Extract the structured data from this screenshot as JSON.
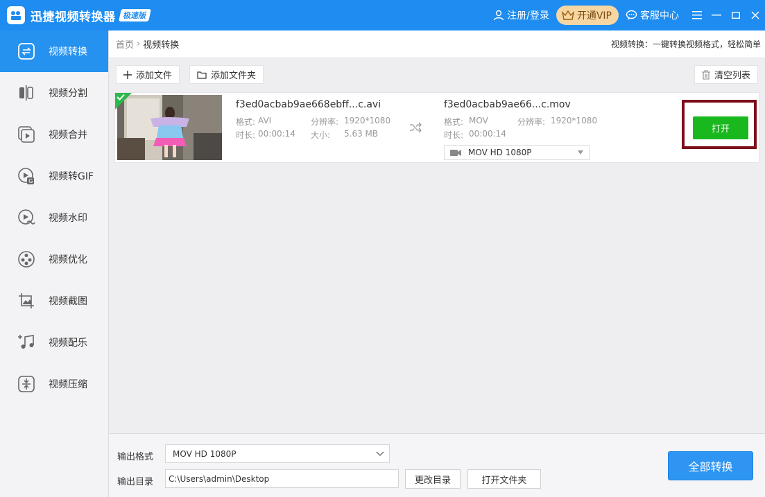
{
  "app": {
    "title": "迅捷视频转换器",
    "edition": "极速版",
    "login_label": "注册/登录",
    "vip_label": "开通VIP",
    "service_label": "客服中心"
  },
  "sidebar": {
    "items": [
      {
        "label": "视频转换",
        "icon": "convert-icon",
        "active": true
      },
      {
        "label": "视频分割",
        "icon": "split-icon"
      },
      {
        "label": "视频合并",
        "icon": "merge-icon"
      },
      {
        "label": "视频转GIF",
        "icon": "gif-icon"
      },
      {
        "label": "视频水印",
        "icon": "watermark-icon"
      },
      {
        "label": "视频优化",
        "icon": "optimize-icon"
      },
      {
        "label": "视频截图",
        "icon": "screenshot-icon"
      },
      {
        "label": "视频配乐",
        "icon": "music-icon"
      },
      {
        "label": "视频压缩",
        "icon": "compress-icon"
      }
    ]
  },
  "breadcrumb": {
    "home": "首页",
    "current": "视频转换"
  },
  "tagline": "视频转换：一键转换视频格式，轻松简单",
  "toolbar": {
    "add_file": "添加文件",
    "add_folder": "添加文件夹",
    "clear_list": "清空列表"
  },
  "file": {
    "source_name": "f3ed0acbab9ae668ebff...c.avi",
    "source_format_label": "格式:",
    "source_format": "AVI",
    "source_resolution_label": "分辨率:",
    "source_resolution": "1920*1080",
    "source_duration_label": "时长:",
    "source_duration": "00:00:14",
    "source_size_label": "大小:",
    "source_size": "5.63 MB",
    "target_name": "f3ed0acbab9ae66...c.mov",
    "target_format_label": "格式:",
    "target_format": "MOV",
    "target_resolution_label": "分辨率:",
    "target_resolution": "1920*1080",
    "target_duration_label": "时长:",
    "target_duration": "00:00:14",
    "target_preset": "MOV  HD 1080P",
    "open_label": "打开"
  },
  "bottom": {
    "output_format_label": "输出格式",
    "output_format_value": "MOV  HD 1080P",
    "output_dir_label": "输出目录",
    "output_dir_value": "C:\\Users\\admin\\Desktop",
    "change_dir": "更改目录",
    "open_folder": "打开文件夹",
    "convert_all": "全部转换"
  },
  "colors": {
    "primary": "#1e8cf0",
    "open_button": "#19b81e",
    "highlight_frame": "#7d0e1a",
    "vip_bg": "#f6d7a3"
  }
}
